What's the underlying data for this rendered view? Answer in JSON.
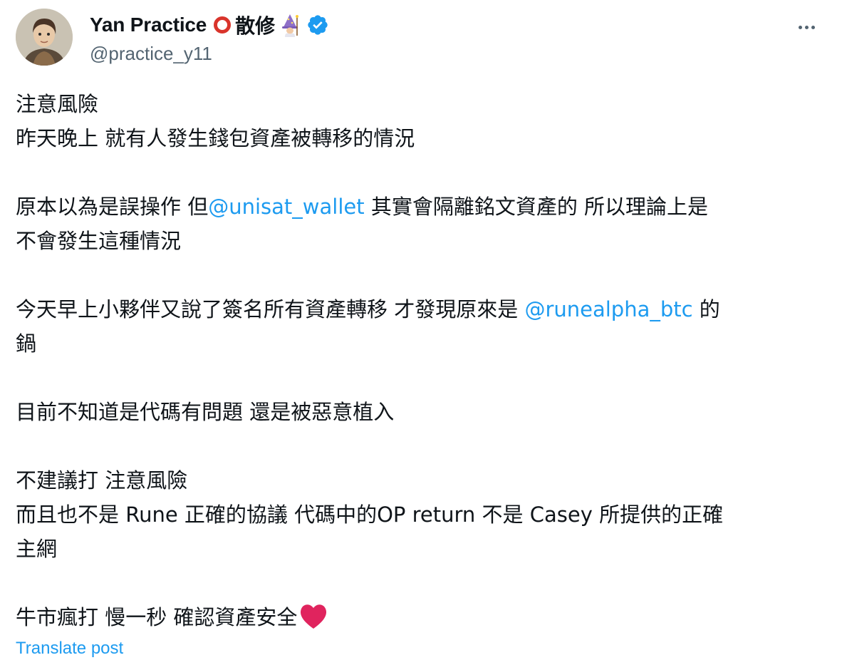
{
  "author": {
    "display_name": "Yan Practice",
    "name_suffix": "散修",
    "handle": "@practice_y11",
    "verified": true
  },
  "icons": {
    "ring": "red-ring-icon",
    "mage": "mage-emoji-icon",
    "verified": "verified-badge-icon",
    "more": "more-options-icon",
    "heart": "red-heart-icon"
  },
  "colors": {
    "text": "#0f1419",
    "secondary": "#536471",
    "link": "#1d9bf0",
    "ring": "#d9342b",
    "heart": "#e0245e"
  },
  "post": {
    "p1": {
      "l1": "注意風險",
      "l2": "昨天晚上 就有人發生錢包資產被轉移的情況"
    },
    "p2": {
      "l1_pre": "原本以為是誤操作 但",
      "l1_mention": "@unisat_wallet",
      "l1_post": " 其實會隔離銘文資產的 所以理論上是",
      "l2": "不會發生這種情況"
    },
    "p3": {
      "l1_pre": "今天早上小夥伴又說了簽名所有資產轉移 才發現原來是 ",
      "l1_mention": "@runealpha_btc",
      "l1_post": " 的",
      "l2": "鍋"
    },
    "p4": {
      "l1": "目前不知道是代碼有問題 還是被惡意植入"
    },
    "p5": {
      "l1": "不建議打 注意風險",
      "l2": "而且也不是 Rune 正確的協議 代碼中的OP return 不是 Casey 所提供的正確",
      "l3": "主網"
    },
    "p6": {
      "l1": "牛市瘋打 慢一秒 確認資產安全"
    }
  },
  "translate_label": "Translate post"
}
